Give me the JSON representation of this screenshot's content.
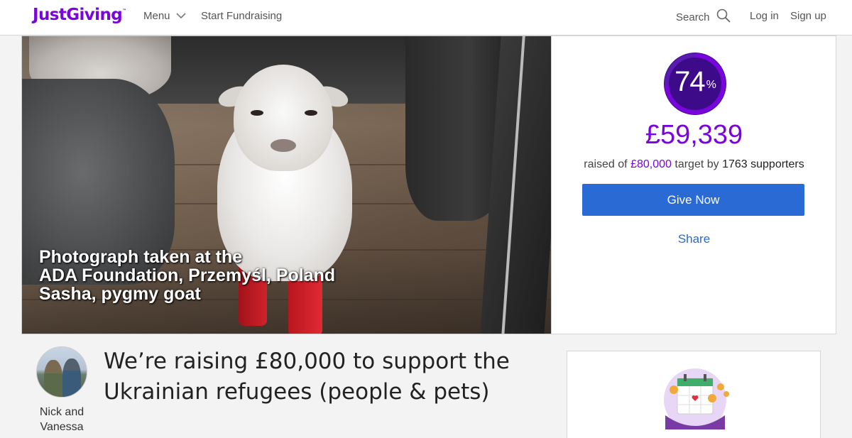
{
  "header": {
    "logo": "JustGiving",
    "logo_tm": "™",
    "menu_label": "Menu",
    "start_label": "Start Fundraising",
    "search_label": "Search",
    "login_label": "Log in",
    "signup_label": "Sign up"
  },
  "hero": {
    "caption": [
      "Photograph taken at the",
      "ADA Foundation, Przemyśl, Poland",
      "Sasha, pygmy goat"
    ]
  },
  "donation": {
    "percent": "74",
    "percent_fraction": 0.74,
    "percent_sign": "%",
    "raised": "£59,339",
    "raised_prefix": "raised of",
    "target": "£80,000",
    "target_suffix": "target by",
    "supporters": "1763 supporters",
    "give_label": "Give Now",
    "share_label": "Share"
  },
  "fundraiser": {
    "owner_line1": "Nick and",
    "owner_line2": "Vanessa",
    "title": "We’re raising £80,000 to support the Ukrainian refugees (people & pets)"
  },
  "colors": {
    "brand_purple": "#7a04dd",
    "button_blue": "#2a6ad4",
    "ring_dark": "#3d0b8a"
  }
}
